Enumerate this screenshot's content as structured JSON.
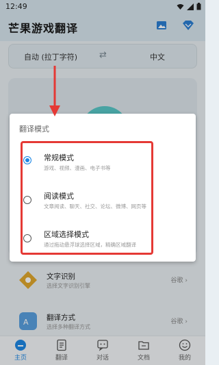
{
  "status_bar": {
    "time": "12:49"
  },
  "header": {
    "app_title": "芒果游戏翻译"
  },
  "language_bar": {
    "source": "自动 (拉丁字符)",
    "swap_symbol": "⇄",
    "target": "中文"
  },
  "dialog": {
    "title": "翻译模式",
    "options": [
      {
        "label": "常规模式",
        "description": "游戏、视频、漫画、电子书等",
        "selected": true
      },
      {
        "label": "阅读模式",
        "description": "文章阅读、聊天、社交、论坛、微博、网页等",
        "selected": false
      },
      {
        "label": "区域选择模式",
        "description": "通过拖动悬浮球选择区域，精确区域翻译",
        "selected": false
      }
    ]
  },
  "settings_list": [
    {
      "title": "文字识别",
      "description": "选择文字识别引擎",
      "value": "谷歌 ›"
    },
    {
      "title": "翻译方式",
      "description": "选择多种翻译方式",
      "value": "谷歌 ›"
    }
  ],
  "tab_bar": {
    "tabs": [
      {
        "label": "主页",
        "active": true
      },
      {
        "label": "翻译",
        "active": false
      },
      {
        "label": "对话",
        "active": false
      },
      {
        "label": "文档",
        "active": false
      },
      {
        "label": "我的",
        "active": false
      }
    ]
  },
  "colors": {
    "accent": "#1e88e5",
    "highlight": "#e53935",
    "teal": "#58c7c7"
  }
}
